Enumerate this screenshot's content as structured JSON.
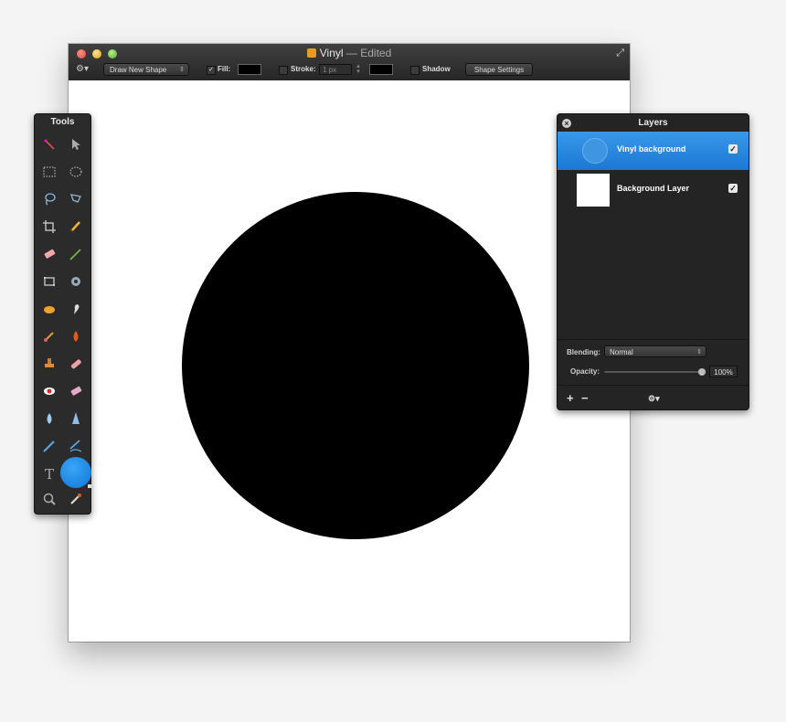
{
  "window": {
    "title": "Vinyl",
    "edited": "— Edited"
  },
  "toolbar": {
    "shape_mode": "Draw New Shape",
    "fill_checked": true,
    "fill_label": "Fill:",
    "fill_color": "#000000",
    "stroke_checked": false,
    "stroke_label": "Stroke:",
    "stroke_width": "1 px",
    "stroke_color": "#000000",
    "shadow_checked": false,
    "shadow_label": "Shadow",
    "shape_settings_label": "Shape Settings"
  },
  "canvas": {
    "background": "#ffffff",
    "shape": "circle",
    "shape_fill": "#000000"
  },
  "tools": {
    "title": "Tools",
    "items": [
      "magic-wand-icon",
      "move-icon",
      "rect-select-icon",
      "ellipse-select-icon",
      "lasso-icon",
      "polygon-lasso-icon",
      "crop-icon",
      "pencil-icon",
      "eraser-icon",
      "brush-icon",
      "transform-icon",
      "vector-icon",
      "paint-bucket-icon",
      "smudge-icon",
      "burn-icon",
      "sharpen-icon",
      "clone-stamp-icon",
      "heal-icon",
      "red-eye-icon",
      "fade-icon",
      "blur-icon",
      "dodge-icon",
      "pen-icon",
      "freeform-icon",
      "text-icon",
      "color-well",
      "zoom-icon",
      "eyedropper-icon"
    ],
    "color_well": "#1a8be8"
  },
  "layers": {
    "title": "Layers",
    "rows": [
      {
        "name": "Vinyl background",
        "visible": true,
        "selected": true
      },
      {
        "name": "Background Layer",
        "visible": true,
        "selected": false
      }
    ],
    "blending_label": "Blending:",
    "blending_value": "Normal",
    "opacity_label": "Opacity:",
    "opacity_value": "100%",
    "add_symbol": "+",
    "remove_symbol": "−",
    "gear_symbol": "⚙▾"
  }
}
